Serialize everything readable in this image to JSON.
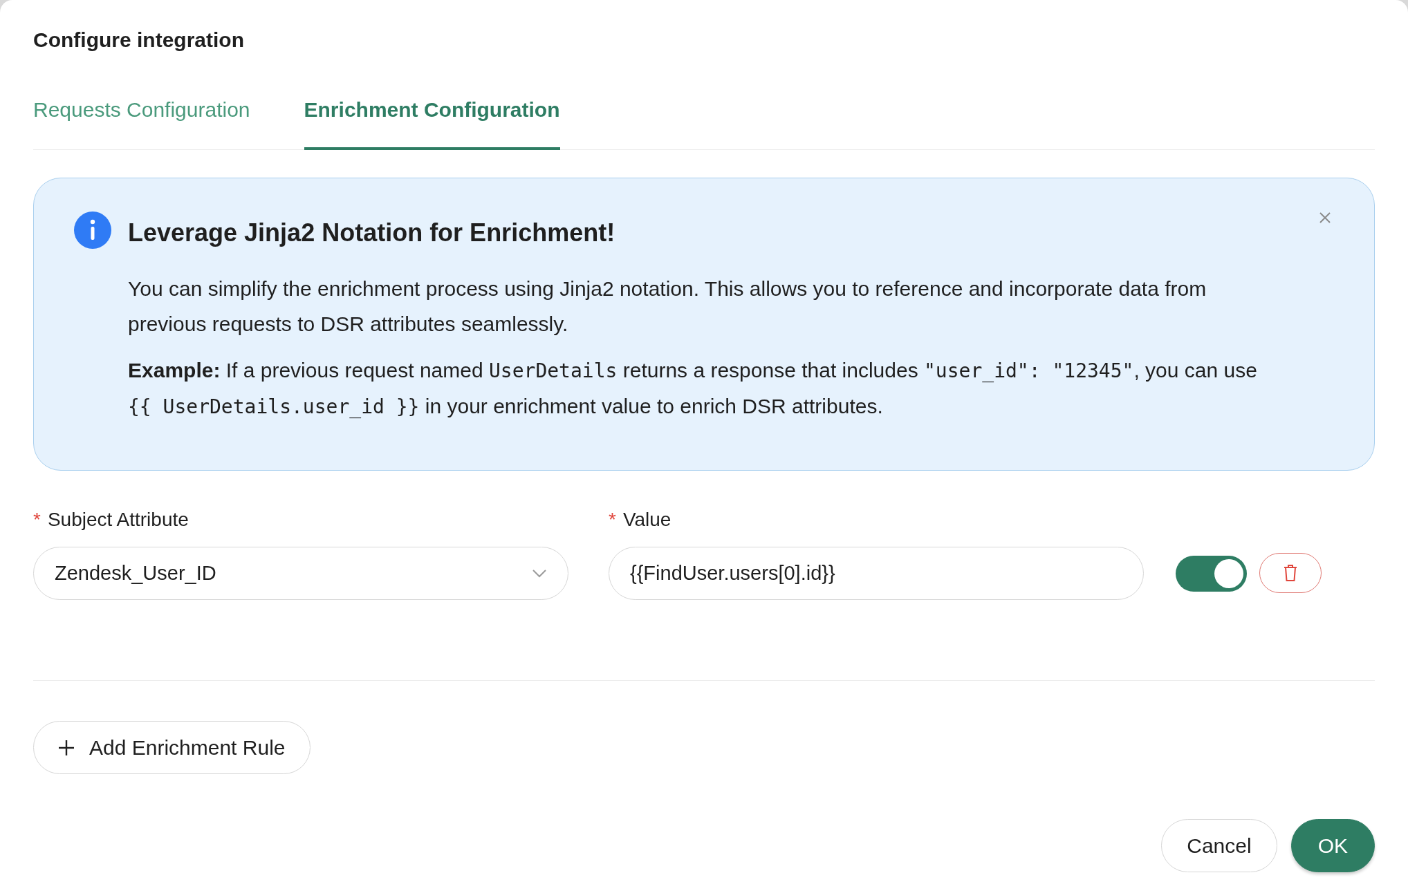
{
  "dialog": {
    "title": "Configure integration"
  },
  "tabs": [
    {
      "label": "Requests Configuration",
      "selected": false
    },
    {
      "label": "Enrichment Configuration",
      "selected": true
    }
  ],
  "alert": {
    "title": "Leverage Jinja2 Notation for Enrichment!",
    "dismissible": true,
    "paragraphs": [
      [
        {
          "kind": "text",
          "text": "You can simplify the enrichment process using Jinja2 notation. This allows you to reference and incorporate data from previous requests to DSR attributes seamlessly."
        }
      ],
      [
        {
          "kind": "text",
          "text": "**Example:** If a previous request named "
        },
        {
          "kind": "code",
          "text": "UserDetails"
        },
        {
          "kind": "text",
          "text": " returns a response that includes "
        },
        {
          "kind": "code",
          "text": "\"user_id\": \"12345\""
        },
        {
          "kind": "text",
          "text": ", you can use "
        },
        {
          "kind": "code",
          "text": "{{ UserDetails.user_id }}"
        },
        {
          "kind": "text",
          "text": " in your enrichment value to enrich DSR attributes."
        }
      ]
    ]
  },
  "rules": [
    {
      "attribute_label": {
        "text": "Subject Attribute",
        "required_mark": "*"
      },
      "attribute": "Zendesk_User_ID",
      "value_label": {
        "text": "Value",
        "required_mark": "*"
      },
      "value": "{{FindUser.users[0].id}}",
      "enabled": true
    }
  ],
  "add_button": {
    "label": "Add Enrichment Rule"
  },
  "buttons": [
    {
      "label": "Cancel",
      "kind": "secondary"
    },
    {
      "label": "OK",
      "kind": "primary"
    }
  ]
}
